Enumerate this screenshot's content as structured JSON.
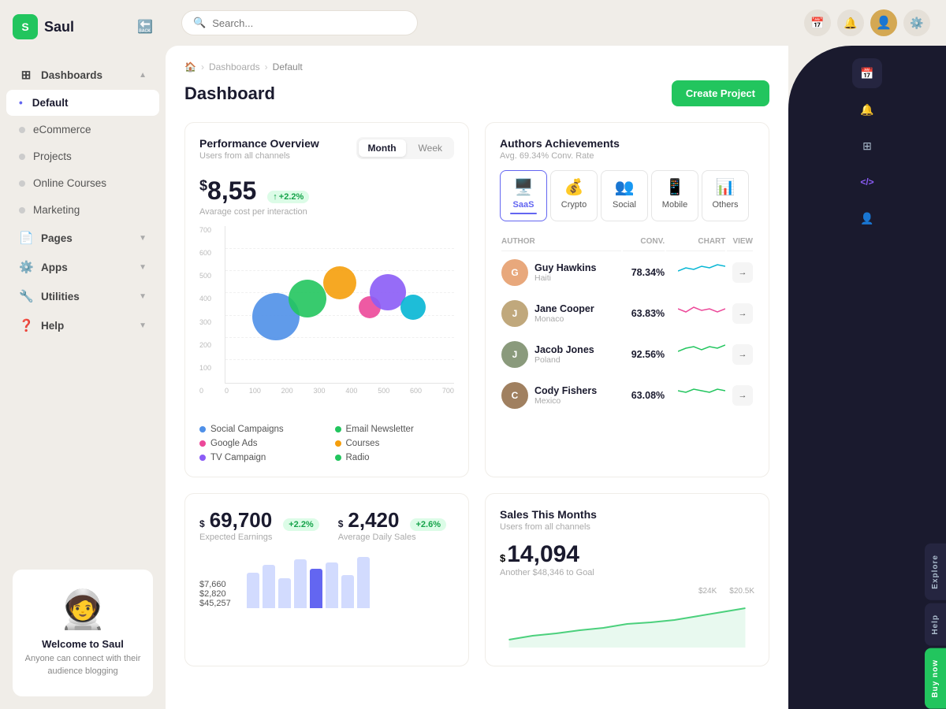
{
  "app": {
    "name": "Saul",
    "logo_letter": "S"
  },
  "topbar": {
    "search_placeholder": "Search...",
    "search_value": ""
  },
  "sidebar": {
    "nav_items": [
      {
        "id": "dashboards",
        "label": "Dashboards",
        "icon": "⊞",
        "has_arrow": true,
        "active": false,
        "is_group": true
      },
      {
        "id": "default",
        "label": "Default",
        "icon": "",
        "active": true,
        "is_sub": true
      },
      {
        "id": "ecommerce",
        "label": "eCommerce",
        "icon": "",
        "active": false,
        "is_sub": true
      },
      {
        "id": "projects",
        "label": "Projects",
        "icon": "",
        "active": false,
        "is_sub": true
      },
      {
        "id": "online-courses",
        "label": "Online Courses",
        "icon": "",
        "active": false,
        "is_sub": true
      },
      {
        "id": "marketing",
        "label": "Marketing",
        "icon": "",
        "active": false,
        "is_sub": true
      },
      {
        "id": "pages",
        "label": "Pages",
        "icon": "📄",
        "has_arrow": true,
        "active": false,
        "is_group": true
      },
      {
        "id": "apps",
        "label": "Apps",
        "icon": "⚙️",
        "has_arrow": true,
        "active": false,
        "is_group": true
      },
      {
        "id": "utilities",
        "label": "Utilities",
        "icon": "🔧",
        "has_arrow": true,
        "active": false,
        "is_group": true
      },
      {
        "id": "help",
        "label": "Help",
        "icon": "❓",
        "has_arrow": true,
        "active": false,
        "is_group": true
      }
    ],
    "welcome": {
      "title": "Welcome to Saul",
      "description": "Anyone can connect with their audience blogging"
    }
  },
  "breadcrumb": {
    "home": "🏠",
    "dashboards": "Dashboards",
    "current": "Default"
  },
  "page_title": "Dashboard",
  "create_btn": "Create Project",
  "performance": {
    "title": "Performance Overview",
    "subtitle": "Users from all channels",
    "tab_month": "Month",
    "tab_week": "Week",
    "active_tab": "Month",
    "metric_value": "8,55",
    "metric_currency": "$",
    "metric_badge": "+2.2%",
    "metric_label": "Avarage cost per interaction",
    "y_labels": [
      "700",
      "600",
      "500",
      "400",
      "300",
      "200",
      "100",
      "0"
    ],
    "x_labels": [
      "0",
      "100",
      "200",
      "300",
      "400",
      "500",
      "600",
      "700"
    ],
    "bubbles": [
      {
        "x": 22,
        "y": 58,
        "size": 60,
        "color": "#4f90e8"
      },
      {
        "x": 36,
        "y": 48,
        "size": 48,
        "color": "#22c55e"
      },
      {
        "x": 50,
        "y": 38,
        "size": 42,
        "color": "#f59e0b"
      },
      {
        "x": 63,
        "y": 52,
        "size": 28,
        "color": "#ec4899"
      },
      {
        "x": 71,
        "y": 45,
        "size": 44,
        "color": "#8b5cf6"
      },
      {
        "x": 82,
        "y": 53,
        "size": 30,
        "color": "#06b6d4"
      }
    ],
    "legend": [
      {
        "label": "Social Campaigns",
        "color": "#4f90e8"
      },
      {
        "label": "Email Newsletter",
        "color": "#22c55e"
      },
      {
        "label": "Google Ads",
        "color": "#ec4899"
      },
      {
        "label": "Courses",
        "color": "#f59e0b"
      },
      {
        "label": "TV Campaign",
        "color": "#8b5cf6"
      },
      {
        "label": "Radio",
        "color": "#22c55e"
      }
    ]
  },
  "authors": {
    "title": "Authors Achievements",
    "subtitle": "Avg. 69.34% Conv. Rate",
    "tabs": [
      {
        "id": "saas",
        "label": "SaaS",
        "icon": "🖥️",
        "active": true
      },
      {
        "id": "crypto",
        "label": "Crypto",
        "icon": "💰",
        "active": false
      },
      {
        "id": "social",
        "label": "Social",
        "icon": "👥",
        "active": false
      },
      {
        "id": "mobile",
        "label": "Mobile",
        "icon": "📱",
        "active": false
      },
      {
        "id": "others",
        "label": "Others",
        "icon": "📊",
        "active": false
      }
    ],
    "col_author": "AUTHOR",
    "col_conv": "CONV.",
    "col_chart": "CHART",
    "col_view": "VIEW",
    "authors": [
      {
        "name": "Guy Hawkins",
        "location": "Haiti",
        "conv": "78.34%",
        "color": "#e8a87c"
      },
      {
        "name": "Jane Cooper",
        "location": "Monaco",
        "conv": "63.83%",
        "color": "#c0a87c"
      },
      {
        "name": "Jacob Jones",
        "location": "Poland",
        "conv": "92.56%",
        "color": "#8a9a7c"
      },
      {
        "name": "Cody Fishers",
        "location": "Mexico",
        "conv": "63.08%",
        "color": "#a08060"
      }
    ]
  },
  "earnings": {
    "amount": "69,700",
    "currency": "$",
    "badge": "+2.2%",
    "label": "Expected Earnings"
  },
  "daily_sales": {
    "amount": "2,420",
    "currency": "$",
    "badge": "+2.6%",
    "label": "Average Daily Sales"
  },
  "bar_values": {
    "v1": "$7,660",
    "v2": "$2,820",
    "v3": "$45,257"
  },
  "sales": {
    "title": "Sales This Months",
    "subtitle": "Users from all channels",
    "currency": "$",
    "amount": "14,094",
    "goal_label": "Another $48,346 to Goal",
    "y1": "$24K",
    "y2": "$20.5K"
  },
  "right_panel": {
    "icons": [
      {
        "id": "calendar",
        "symbol": "📅"
      },
      {
        "id": "notifications",
        "symbol": "🔔"
      },
      {
        "id": "settings",
        "symbol": "⚙️"
      },
      {
        "id": "code",
        "symbol": "<>"
      },
      {
        "id": "user",
        "symbol": "👤"
      }
    ],
    "btns": [
      "Explore",
      "Help",
      "Buy now"
    ]
  }
}
